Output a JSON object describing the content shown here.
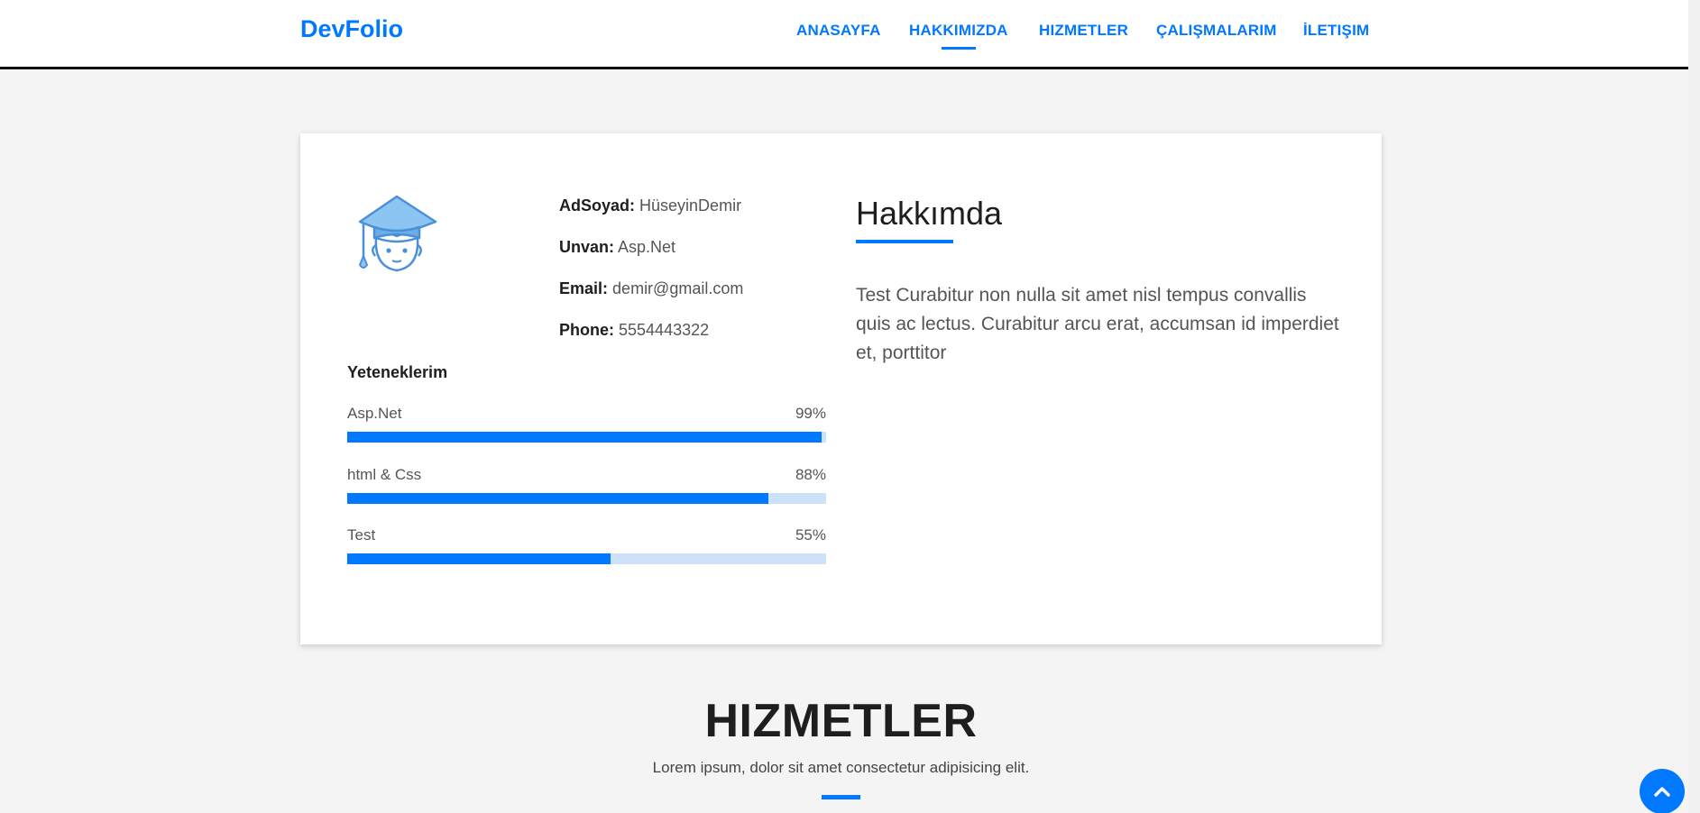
{
  "nav": {
    "brand": "DevFolio",
    "items": [
      {
        "label": "ANASAYFA"
      },
      {
        "label": "HAKKIMIZDA"
      },
      {
        "label": "HIZMETLER"
      },
      {
        "label": "ÇALIŞMALARIM"
      },
      {
        "label": "İLETIŞIM"
      }
    ],
    "active_item": "HAKKIMIZDA"
  },
  "profile": {
    "avatar_icon": "graduate-avatar-icon",
    "fields": [
      {
        "label": "AdSoyad:",
        "value": "HüseyinDemir"
      },
      {
        "label": "Unvan:",
        "value": "Asp.Net"
      },
      {
        "label": "Email:",
        "value": "demir@gmail.com"
      },
      {
        "label": "Phone:",
        "value": "5554443322"
      }
    ]
  },
  "skills": {
    "title": "Yeteneklerim",
    "items": [
      {
        "name": "Asp.Net",
        "percent_label": "99%",
        "percent": 99
      },
      {
        "name": "html & Css",
        "percent_label": "88%",
        "percent": 88
      },
      {
        "name": "Test",
        "percent_label": "55%",
        "percent": 55
      }
    ]
  },
  "about": {
    "title": "Hakkımda",
    "text": "Test Curabitur non nulla sit amet nisl tempus convallis quis ac lectus. Curabitur arcu erat, accumsan id imperdiet et, porttitor"
  },
  "services_section": {
    "title": "HIZMETLER",
    "subtitle": "Lorem ipsum, dolor sit amet consectetur adipisicing elit."
  },
  "back_to_top": {
    "icon": "chevron-up-icon"
  },
  "colors": {
    "accent": "#0078ff",
    "bar_track": "#cde1f8",
    "page_bg": "#f4f4f4",
    "card_bg": "#ffffff",
    "avatar_blue": "#6aaee8"
  }
}
